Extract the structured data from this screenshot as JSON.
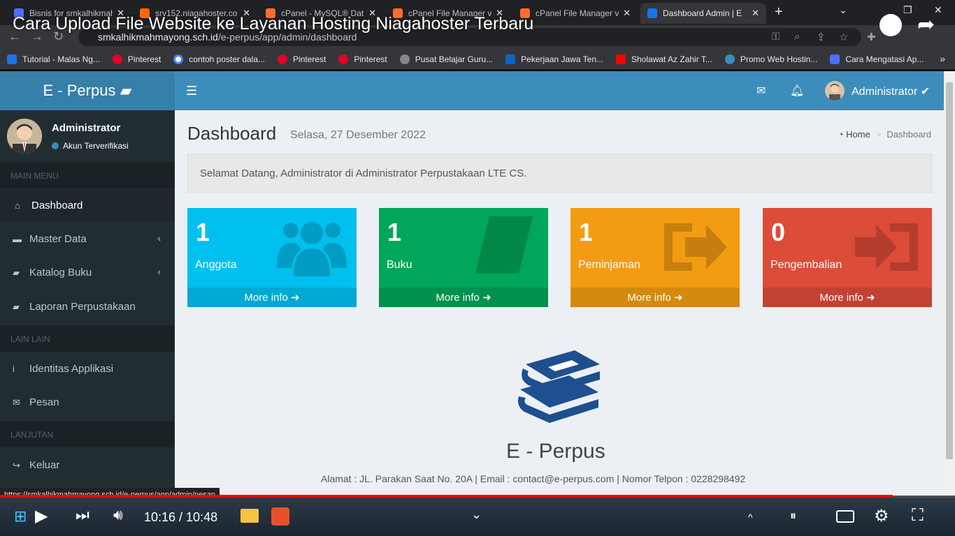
{
  "browser": {
    "tabs": [
      {
        "title": "Bisnis for smkalhikmah",
        "color": "#4b6fff"
      },
      {
        "title": "srv152.niagahoster.co",
        "color": "#ff6a00"
      },
      {
        "title": "cPanel - MySQL® Dat",
        "color": "#ff6c2c"
      },
      {
        "title": "cPanel File Manager v",
        "color": "#ff6c2c"
      },
      {
        "title": "cPanel File Manager v",
        "color": "#ff6c2c"
      },
      {
        "title": "Dashboard Admin | E",
        "color": "#1a73e8"
      }
    ],
    "url_host": "smkalhikmahmayong.sch.id",
    "url_path": "/e-perpus/app/admin/dashboard",
    "bookmarks": [
      {
        "label": "Tutorial - Malas Ng...",
        "color": "#1a73e8"
      },
      {
        "label": "Pinterest",
        "color": "#e60023"
      },
      {
        "label": "contoh poster dala...",
        "color": "#4285f4"
      },
      {
        "label": "Pinterest",
        "color": "#e60023"
      },
      {
        "label": "Pinterest",
        "color": "#e60023"
      },
      {
        "label": "Pusat Belajar Guru...",
        "color": "#888888"
      },
      {
        "label": "Pekerjaan Jawa Ten...",
        "color": "#0a66c2"
      },
      {
        "label": "Sholawat Az Zahir T...",
        "color": "#ff0000"
      },
      {
        "label": "Promo Web Hostin...",
        "color": "#3c8dbc"
      },
      {
        "label": "Cara Mengatasi Ap...",
        "color": "#4b6fff"
      }
    ]
  },
  "video": {
    "title": "Cara Upload File Website ke Layanan Hosting Niagahoster Terbaru",
    "time": "10:16 / 10:48",
    "progress": 0.935
  },
  "app": {
    "brand": "E - Perpus",
    "nav_user": "Administrator",
    "sidebar": {
      "user_name": "Administrator",
      "user_status": "Akun Terverifikasi",
      "headers": [
        "MAIN MENU",
        "LAIN LAIN",
        "LANJUTAN"
      ],
      "items": [
        {
          "label": "Dashboard",
          "icon": "home-icon"
        },
        {
          "label": "Master Data",
          "icon": "folder-icon"
        },
        {
          "label": "Katalog Buku",
          "icon": "book-icon"
        },
        {
          "label": "Laporan Perpustakaan",
          "icon": "book-icon"
        },
        {
          "label": "Identitas Applikasi",
          "icon": "info-icon"
        },
        {
          "label": "Pesan",
          "icon": "envelope-icon"
        },
        {
          "label": "Keluar",
          "icon": "sign-out-icon"
        }
      ]
    },
    "page_title": "Dashboard",
    "page_date": "Selasa, 27 Desember 2022",
    "breadcrumb": {
      "home": "Home",
      "current": "Dashboard"
    },
    "welcome": "Selamat Datang, Administrator di Administrator Perpustakaan LTE CS.",
    "boxes": [
      {
        "value": "1",
        "label": "Anggota",
        "footer": "More info",
        "color": "#00c0ef",
        "icon": "users-icon"
      },
      {
        "value": "1",
        "label": "Buku",
        "footer": "More info",
        "color": "#00a65a",
        "icon": "book-icon"
      },
      {
        "value": "1",
        "label": "Peminjaman",
        "footer": "More info",
        "color": "#f39c12",
        "icon": "share-icon"
      },
      {
        "value": "0",
        "label": "Pengembalian",
        "footer": "More info",
        "color": "#dd4b39",
        "icon": "sign-in-icon"
      }
    ],
    "footer_brand": "E - Perpus",
    "footer_address": "Alamat : JL. Parakan Saat No. 20A | Email : contact@e-perpus.com | Nomor Telpon : 0228298492"
  },
  "status_url": "https://smkalhikmahmayong.sch.id/e-perpus/app/admin/pesan"
}
